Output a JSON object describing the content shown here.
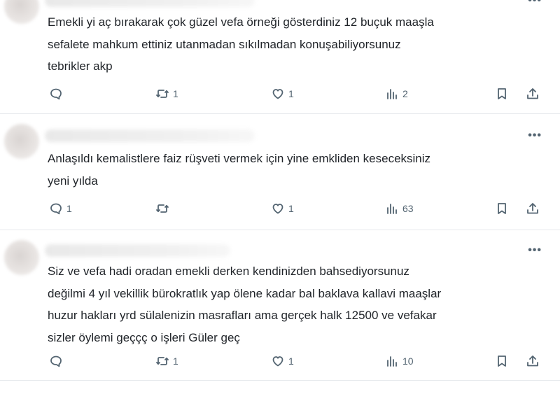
{
  "replies": [
    {
      "text": "Emekli yi aç bırakarak çok güzel vefa örneği gösterdiniz 12 buçuk maaşla\nsefalete mahkum ettiniz utanmadan sıkılmadan konuşabiliyorsunuz\ntebrikler akp",
      "reply_count": "",
      "retweet_count": "1",
      "like_count": "1",
      "view_count": "2"
    },
    {
      "text": "Anlaşıldı kemalistlere faiz rüşveti vermek için yine emkliden keseceksiniz\nyeni yılda",
      "reply_count": "1",
      "retweet_count": "",
      "like_count": "1",
      "view_count": "63"
    },
    {
      "text": "Siz ve vefa hadi oradan emekli derken kendinizden bahsediyorsunuz\ndeğilmi 4 yıl vekillik bürokratlık yap ölene kadar bal baklava kallavi maaşlar\nhuzur hakları yrd sülalenizin masrafları ama gerçek halk 12500 ve vefakar\nsizler öylemi geççç o işleri Güler geç",
      "reply_count": "",
      "retweet_count": "1",
      "like_count": "1",
      "view_count": "10"
    }
  ],
  "icons": {
    "more": "more-horizontal-icon",
    "reply": "reply-bubble-icon",
    "retweet": "retweet-icon",
    "like": "heart-icon",
    "views": "views-bar-chart-icon",
    "bookmark": "bookmark-icon",
    "share": "share-upload-icon"
  },
  "colors": {
    "icon_gray": "#536471",
    "text": "#1f2328",
    "divider": "#e6e9ec"
  },
  "more_label": "•••"
}
